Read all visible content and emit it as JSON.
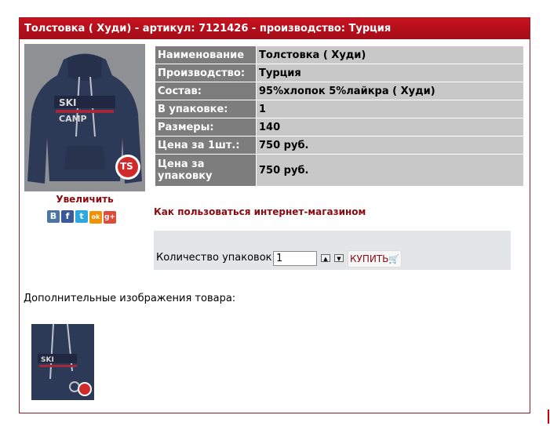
{
  "product": {
    "title": "Толстовка ( Худи) - артикул: 7121426 - производство: Турция",
    "zoom_label": "Увеличить",
    "properties": [
      {
        "key": "Наименование",
        "value": "Толстовка ( Худи)"
      },
      {
        "key": "Производство:",
        "value": "Турция"
      },
      {
        "key": "Состав:",
        "value": "95%хлопок 5%лайкра ( Худи)"
      },
      {
        "key": "В упаковке:",
        "value": "1"
      },
      {
        "key": "Размеры:",
        "value": "140"
      },
      {
        "key": "Цена за 1шт.:",
        "value": "750 руб."
      },
      {
        "key": "Цена за упаковку",
        "value": "750 руб."
      }
    ],
    "howto_link": "Как пользоваться интернет-магазином",
    "quantity_label": "Количество упаковок:",
    "quantity_value": "1",
    "buy_label": "КУПИТЬ",
    "extra_images_label": "Дополнительные изображения товара:",
    "brand_badge": "TS"
  },
  "social": {
    "icons": [
      {
        "name": "vk",
        "glyph": "B",
        "color": "#4c75a3"
      },
      {
        "name": "facebook",
        "glyph": "f",
        "color": "#3b5998"
      },
      {
        "name": "twitter",
        "glyph": "t",
        "color": "#2ca7e0"
      },
      {
        "name": "odnoklassniki",
        "glyph": "ok",
        "color": "#f39200"
      },
      {
        "name": "google-plus",
        "glyph": "g+",
        "color": "#dd4b39"
      }
    ]
  },
  "colors": {
    "accent": "#b30f1b",
    "link": "#8b0a12",
    "table_key_bg": "#7d7d7d",
    "table_value_bg": "#c8c8c8",
    "buy_box_bg": "#e3e5e6"
  }
}
